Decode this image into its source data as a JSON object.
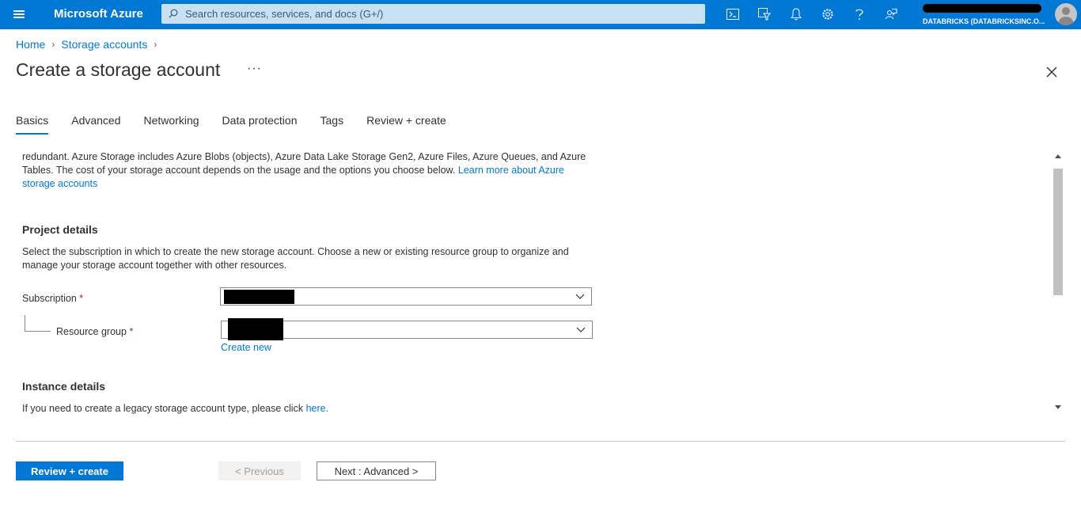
{
  "topbar": {
    "brand": "Microsoft Azure",
    "search_placeholder": "Search resources, services, and docs (G+/)",
    "directory": "DATABRICKS (DATABRICKSINC.O..."
  },
  "breadcrumb": {
    "items": [
      "Home",
      "Storage accounts"
    ]
  },
  "page": {
    "title": "Create a storage account",
    "more_label": "···"
  },
  "tabs": [
    "Basics",
    "Advanced",
    "Networking",
    "Data protection",
    "Tags",
    "Review + create"
  ],
  "content": {
    "intro_text": "redundant. Azure Storage includes Azure Blobs (objects), Azure Data Lake Storage Gen2, Azure Files, Azure Queues, and Azure Tables. The cost of your storage account depends on the usage and the options you choose below.",
    "intro_link": "Learn more about Azure storage accounts",
    "project_heading": "Project details",
    "project_text": "Select the subscription in which to create the new storage account. Choose a new or existing resource group to organize and manage your storage account together with other resources.",
    "subscription_label": "Subscription",
    "resource_group_label": "Resource group",
    "required_mark": "*",
    "create_new_link": "Create new",
    "instance_heading": "Instance details",
    "instance_text": "If you need to create a legacy storage account type, please click",
    "instance_link": "here."
  },
  "footer": {
    "review_create": "Review + create",
    "previous": "< Previous",
    "next": "Next : Advanced >"
  },
  "colors": {
    "accent": "#0078d4",
    "topbar": "#0078d4",
    "required": "#a4262c"
  },
  "icons": [
    "hamburger-icon",
    "search-icon",
    "cloud-shell-icon",
    "directory-filter-icon",
    "notifications-icon",
    "settings-icon",
    "help-icon",
    "feedback-icon",
    "close-icon",
    "chevron-down-icon"
  ]
}
